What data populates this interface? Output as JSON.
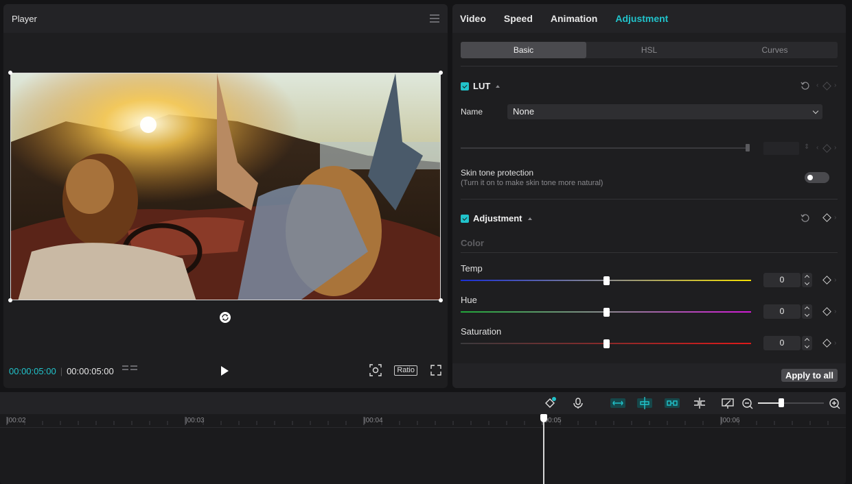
{
  "player": {
    "title": "Player",
    "timecode_current": "00:00:05:00",
    "timecode_total": "00:00:05:00",
    "ratio_label": "Ratio"
  },
  "tabs": [
    {
      "label": "Video",
      "active": false
    },
    {
      "label": "Speed",
      "active": false
    },
    {
      "label": "Animation",
      "active": false
    },
    {
      "label": "Adjustment",
      "active": true
    }
  ],
  "subtabs": [
    {
      "label": "Basic",
      "active": true
    },
    {
      "label": "HSL",
      "active": false
    },
    {
      "label": "Curves",
      "active": false
    }
  ],
  "lut": {
    "title": "LUT",
    "name_label": "Name",
    "name_value": "None",
    "skin_tone_label": "Skin tone protection",
    "skin_tone_hint": "(Turn it on to make skin tone more natural)",
    "skin_tone_on": false
  },
  "adjustment": {
    "title": "Adjustment",
    "color_group_label": "Color",
    "sliders": [
      {
        "label": "Temp",
        "value": "0",
        "position": 0.5,
        "gradient": "linear-gradient(90deg,#1a2fd6,#8a8a8e 50%,#f5e000)"
      },
      {
        "label": "Hue",
        "value": "0",
        "position": 0.5,
        "gradient": "linear-gradient(90deg,#21a83a,#8a8a8e 50%,#d21ad6)"
      },
      {
        "label": "Saturation",
        "value": "0",
        "position": 0.5,
        "gradient": "linear-gradient(90deg,#3a3a3d,#8a2a2a 50%,#e01a1a)"
      }
    ]
  },
  "apply_all_label": "Apply to all",
  "timeline": {
    "ticks": [
      "|00:02",
      "|00:03",
      "|00:04",
      "|00:05",
      "|00:06"
    ],
    "zoom_level": 0.35
  },
  "colors": {
    "accent": "#21c3cb"
  }
}
